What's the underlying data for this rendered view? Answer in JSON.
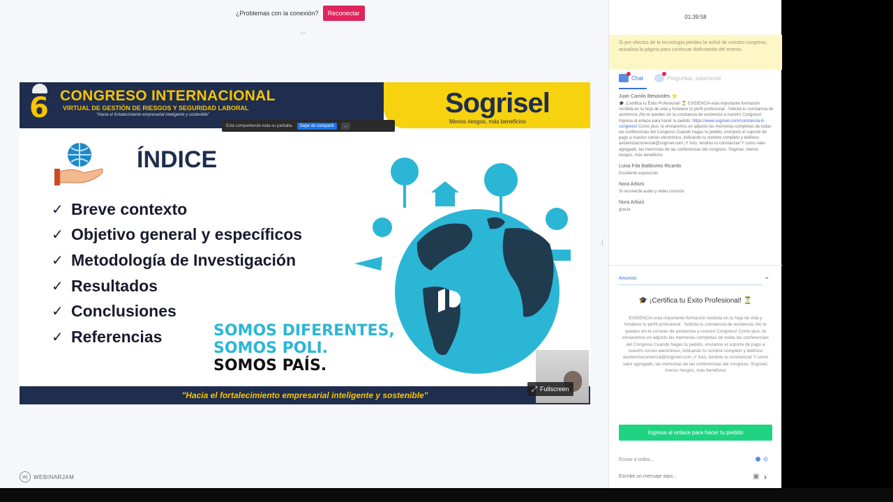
{
  "connection": {
    "question": "¿Problemas con la conexión?",
    "reconnect_label": "Reconectar",
    "dots": "..."
  },
  "slide": {
    "edition_number": "6",
    "event_title": "CONGRESO INTERNACIONAL",
    "event_subtitle": "VIRTUAL DE GESTIÓN DE RIESGOS Y SEGURIDAD LABORAL",
    "event_tagline_small": "\"Hacia el fortalecimiento empresarial inteligente y sostenible\"",
    "brand": "Sogrisel",
    "brand_slogan": "Menos riesgos, más beneficios",
    "share_banner": {
      "text": "Está compartiendo toda su pantalla.",
      "stop_label": "Dejar de compartir",
      "hide_label": "..."
    },
    "heading": "ÍNDICE",
    "items": [
      "Breve contexto",
      "Objetivo general y específicos",
      "Metodología de Investigación",
      "Resultados",
      "Conclusiones",
      "Referencias"
    ],
    "check_symbol": "✓",
    "motto_lines": [
      "SOMOS DIFERENTES,",
      "SOMOS POLI.",
      "SOMOS PAÍS."
    ],
    "footer": "\"Hacia el fortalecimiento empresarial inteligente y sostenible\""
  },
  "video": {
    "fullscreen_label": "Fullscreen"
  },
  "platform": {
    "logo_text": "WEBINARJAM"
  },
  "sidebar": {
    "timer": "01:39:58",
    "notice": "Si por efectos de la tecnología pierdes la señal de nuestro congreso, actualiza la página para continuar disfrutando del evento.",
    "tabs": [
      {
        "label": "Chat"
      },
      {
        "label": "Preguntas, solamente"
      }
    ],
    "messages": [
      {
        "author": "Juan Camilo Benavides ⭐",
        "text": "🎓 ¡Certifica tu Éxito Profesional! ⏳ EVIDENCIA esta importante formación recibida en tu hoja de vida y fortalece tu perfil profesional . Solicita tu constancia de asistencia ¡No te quedes sin la constancia de asistencia a nuestro Congreso! Ingresa al enlace para hacer tu pedido:",
        "link": "https://www.sogrisel.com/constancia-6-congreso/",
        "text2": "Como plus, te enviaremos en adjunto las memorias completas de todas las conferencias del Congreso Cuando hagas tu pedido, envíanos el soporte de pago a nuestro correo electrónico, indicando tu nombre completo y teléfono asistenciacomercial@sogrisel.com ¡Y listo, tendrás tu constancia! Y como valor agregado, las memorias de las conferencias del congreso. Sogrisel, menos riesgos, más beneficios"
      },
      {
        "author": "Luisa Fda Baldovino Ricardo",
        "text": "Excelente exposición"
      },
      {
        "author": "Nora Arbizú",
        "text": "Si reconecté audio y video correcto"
      },
      {
        "author": "Nora Arbizú",
        "text": "gracia"
      }
    ],
    "announcement": {
      "tab_label": "Anuncio",
      "title": "🎓 ¡Certifica tu Éxito Profesional! ⏳",
      "body": "EVIDENCIA esta importante formación recibida en tu hoja de vida y fortalece tu perfil profesional . Solicita tu constancia de asistencia ¡No te quedes sin la constan de asistencia a nuestro Congreso! Como plus, te enviaremos en adjunto las memorias completas de todas las conferencias del Congreso Cuando hagas tu pedido, envíanos el soporte de pago a nuestro correo electrónico, indicando tu nombre completo y teléfono asistenciacomercial@sogrisel.com ¡Y listo, tendrás tu constancia! Y como valor agregado, las memorias de las conferencias del congreso. Sogrisel, menos riesgos, más beneficios",
      "cta_label": "Ingresa al enlace para hacer tu pedido"
    },
    "send_to": "Enviar a todos...",
    "message_placeholder": "Escribe un mensaje aquí..."
  },
  "colors": {
    "navy": "#1f2d4e",
    "yellow": "#f7d20e",
    "accent_red": "#e0245e",
    "cta_green": "#1ed483",
    "link_blue": "#3b6fd8"
  }
}
